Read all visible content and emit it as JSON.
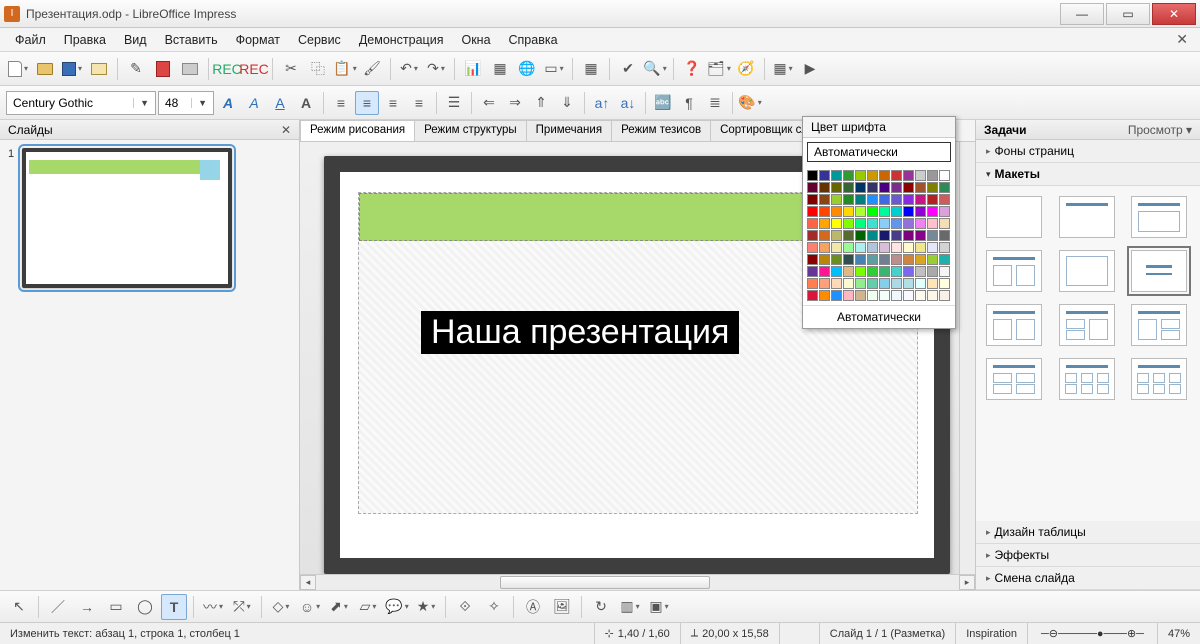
{
  "window": {
    "title": "Презентация.odp - LibreOffice Impress"
  },
  "menu": [
    "Файл",
    "Правка",
    "Вид",
    "Вставить",
    "Формат",
    "Сервис",
    "Демонстрация",
    "Окна",
    "Справка"
  ],
  "font": {
    "name": "Century Gothic",
    "size": "48"
  },
  "panels": {
    "slides_title": "Слайды",
    "tasks_title": "Задачи",
    "tasks_view": "Просмотр",
    "sections": {
      "backgrounds": "Фоны страниц",
      "layouts": "Макеты",
      "table_design": "Дизайн таблицы",
      "effects": "Эффекты",
      "transition": "Смена слайда"
    }
  },
  "view_tabs": [
    "Режим рисования",
    "Режим структуры",
    "Примечания",
    "Режим тезисов",
    "Сортировщик слайдов"
  ],
  "active_tab": 0,
  "slide_number": "1",
  "slide_title_text": "Наша презентация",
  "color_popup": {
    "header": "Цвет шрифта",
    "auto_top": "Автоматически",
    "auto_bottom": "Автоматически",
    "colors": [
      "#000000",
      "#333399",
      "#009999",
      "#339933",
      "#99cc00",
      "#cc9900",
      "#cc6600",
      "#cc3333",
      "#993399",
      "#cccccc",
      "#999999",
      "#ffffff",
      "#660033",
      "#663300",
      "#666600",
      "#336633",
      "#003366",
      "#333366",
      "#4b0082",
      "#7b2d8e",
      "#8b0000",
      "#a0522d",
      "#808000",
      "#2e8b57",
      "#800000",
      "#8b4513",
      "#9acd32",
      "#228b22",
      "#008080",
      "#1e90ff",
      "#4169e1",
      "#6a5acd",
      "#8a2be2",
      "#c71585",
      "#b22222",
      "#cd5c5c",
      "#ff0000",
      "#ff4500",
      "#ff8c00",
      "#ffd700",
      "#adff2f",
      "#00ff00",
      "#00fa9a",
      "#00ced1",
      "#0000ff",
      "#9400d3",
      "#ff00ff",
      "#dda0dd",
      "#ff6347",
      "#ffa500",
      "#ffff00",
      "#7fff00",
      "#00ff7f",
      "#40e0d0",
      "#87cefa",
      "#6495ed",
      "#9370db",
      "#ee82ee",
      "#ffc0cb",
      "#f5deb3",
      "#a52a2a",
      "#d2691e",
      "#bdb76b",
      "#556b2f",
      "#006400",
      "#008b8b",
      "#191970",
      "#483d8b",
      "#800080",
      "#8b008b",
      "#778899",
      "#696969",
      "#fa8072",
      "#f4a460",
      "#eee8aa",
      "#98fb98",
      "#afeeee",
      "#b0c4de",
      "#d8bfd8",
      "#ffe4e1",
      "#fffacd",
      "#f0e68c",
      "#e6e6fa",
      "#d3d3d3",
      "#8b0000",
      "#b8860b",
      "#6b8e23",
      "#2f4f4f",
      "#4682b4",
      "#5f9ea0",
      "#708090",
      "#bc8f8f",
      "#cd853f",
      "#daa520",
      "#9acd32",
      "#20b2aa",
      "#663399",
      "#ff1493",
      "#00bfff",
      "#deb887",
      "#7cfc00",
      "#32cd32",
      "#3cb371",
      "#48d1cc",
      "#7b68ee",
      "#c0c0c0",
      "#a9a9a9",
      "#f5f5f5",
      "#ff7f50",
      "#ffa07a",
      "#ffdab9",
      "#fafad2",
      "#90ee90",
      "#66cdaa",
      "#87ceeb",
      "#add8e6",
      "#b0e0e6",
      "#e0ffff",
      "#ffe4b5",
      "#ffffe0",
      "#dc143c",
      "#ff8c00",
      "#1e90ff",
      "#ffb6c1",
      "#d2b48c",
      "#f0fff0",
      "#f5fffa",
      "#f0f8ff",
      "#f8f8ff",
      "#fffaf0",
      "#fdf5e6",
      "#faf0e6"
    ]
  },
  "status": {
    "edit_text": "Изменить текст: абзац 1, строка 1, столбец 1",
    "pos": "1,40 / 1,60",
    "size": "20,00 x 15,58",
    "slide": "Слайд 1 / 1 (Разметка)",
    "theme": "Inspiration",
    "zoom": "47%"
  }
}
